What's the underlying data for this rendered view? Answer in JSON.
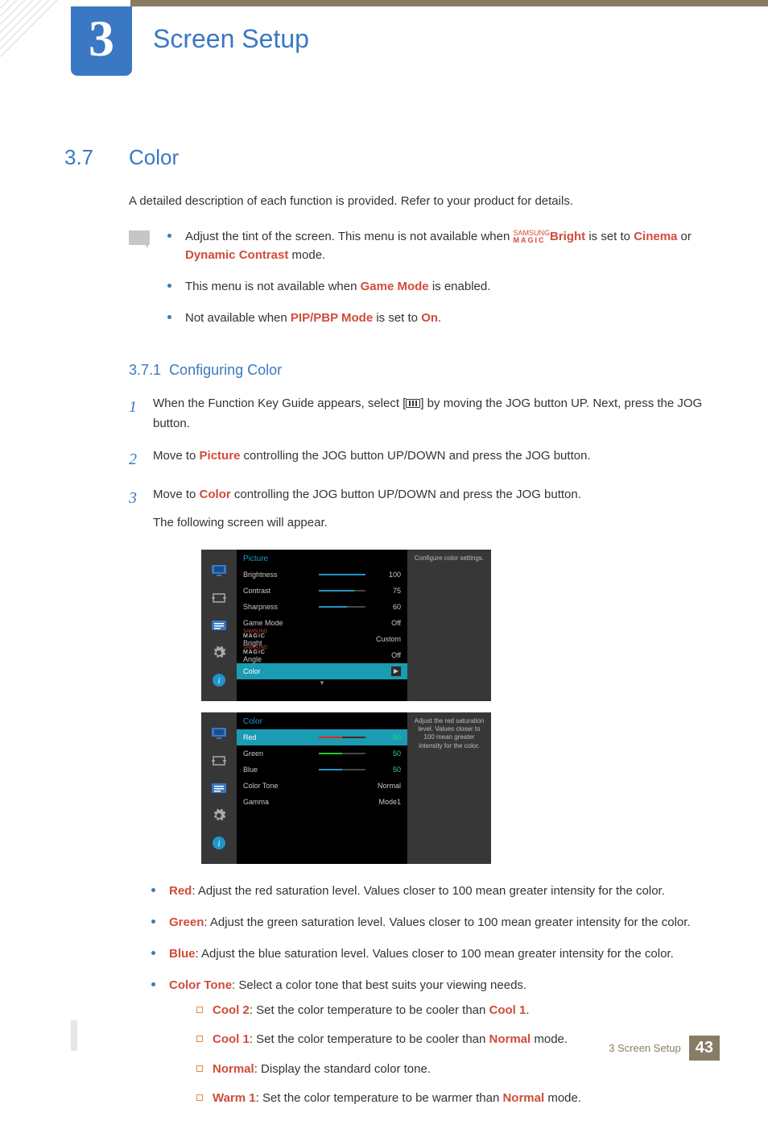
{
  "chapter": {
    "number": "3",
    "title": "Screen Setup"
  },
  "section": {
    "number": "3.7",
    "title": "Color"
  },
  "intro": "A detailed description of each function is provided. Refer to your product for details.",
  "notes": {
    "n1a": "Adjust the tint of the screen. This menu is not available when ",
    "n1_magic1": "SAMSUNG",
    "n1_magic2": "MAGIC",
    "n1_bright": "Bright",
    "n1b": " is set to ",
    "n1_cinema": "Cinema",
    "n1c": " or ",
    "n1_dc": "Dynamic Contrast",
    "n1d": " mode.",
    "n2a": "This menu is not available when ",
    "n2_gm": "Game Mode",
    "n2b": " is enabled.",
    "n3a": "Not available when ",
    "n3_pp": "PIP/PBP Mode",
    "n3b": " is set to ",
    "n3_on": "On",
    "n3c": "."
  },
  "subsection": {
    "number": "3.7.1",
    "title": "Configuring Color"
  },
  "steps": {
    "s1a": "When the Function Key Guide appears, select [",
    "s1b": "] by moving the JOG button UP. Next, press the JOG button.",
    "s2a": "Move to ",
    "s2_pic": "Picture",
    "s2b": " controlling the JOG button UP/DOWN and press the JOG button.",
    "s3a": "Move to ",
    "s3_col": "Color",
    "s3b": " controlling the JOG button UP/DOWN and press the JOG button.",
    "s3c": "The following screen will appear."
  },
  "osd1": {
    "title": "Picture",
    "help": "Configure color settings.",
    "rows": {
      "brightness": {
        "label": "Brightness",
        "val": "100"
      },
      "contrast": {
        "label": "Contrast",
        "val": "75"
      },
      "sharpness": {
        "label": "Sharpness",
        "val": "60"
      },
      "gamemode": {
        "label": "Game Mode",
        "val": "Off"
      },
      "magicbright": {
        "suffix": "Bright",
        "val": "Custom"
      },
      "magicangle": {
        "suffix": "Angle",
        "val": "Off"
      },
      "color": {
        "label": "Color"
      }
    }
  },
  "osd2": {
    "title": "Color",
    "help": "Adjust the red saturation level. Values closer to 100 mean greater intensity for the color.",
    "rows": {
      "red": {
        "label": "Red",
        "val": "50"
      },
      "green": {
        "label": "Green",
        "val": "50"
      },
      "blue": {
        "label": "Blue",
        "val": "50"
      },
      "colortone": {
        "label": "Color Tone",
        "val": "Normal"
      },
      "gamma": {
        "label": "Gamma",
        "val": "Mode1"
      }
    }
  },
  "descriptions": {
    "red_l": "Red",
    "red_t": ": Adjust the red saturation level. Values closer to 100 mean greater intensity for the color.",
    "green_l": "Green",
    "green_t": ": Adjust the green saturation level. Values closer to 100 mean greater intensity for the color.",
    "blue_l": "Blue",
    "blue_t": ": Adjust the blue saturation level. Values closer to 100 mean greater intensity for the color.",
    "ct_l": "Color Tone",
    "ct_t": ": Select a color tone that best suits your viewing needs.",
    "cool2_l": "Cool 2",
    "cool2_a": ": Set the color temperature to be cooler than ",
    "cool2_k": "Cool 1",
    "cool2_b": ".",
    "cool1_l": "Cool 1",
    "cool1_a": ": Set the color temperature to be cooler than ",
    "cool1_k": "Normal",
    "cool1_b": " mode.",
    "normal_l": "Normal",
    "normal_t": ": Display the standard color tone.",
    "warm1_l": "Warm 1",
    "warm1_a": ": Set the color temperature to be warmer than ",
    "warm1_k": "Normal",
    "warm1_b": " mode."
  },
  "footer": {
    "section": "3 Screen Setup",
    "page": "43"
  }
}
